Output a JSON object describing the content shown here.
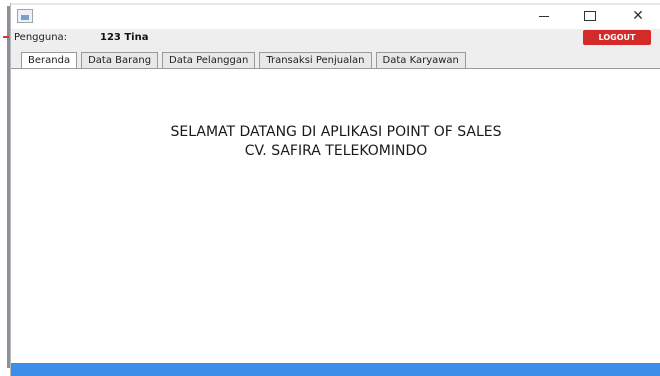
{
  "window": {
    "icon": "java-app-icon",
    "controls": [
      "minimize-icon",
      "maximize-icon",
      "close-icon"
    ],
    "close_glyph": "✕"
  },
  "user": {
    "label": "Pengguna:",
    "value": "123 Tina"
  },
  "logout_label": "LOGOUT",
  "tabs": [
    {
      "label": "Beranda",
      "active": true
    },
    {
      "label": "Data Barang",
      "active": false
    },
    {
      "label": "Data Pelanggan",
      "active": false
    },
    {
      "label": "Transaksi Penjualan",
      "active": false
    },
    {
      "label": "Data Karyawan",
      "active": false
    }
  ],
  "welcome": {
    "line1": "SELAMAT DATANG DI APLIKASI POINT OF SALES",
    "line2": "CV. SAFIRA TELEKOMINDO"
  },
  "colors": {
    "logout": "#d42a2a",
    "bottom_bar": "#3d8ee8"
  }
}
